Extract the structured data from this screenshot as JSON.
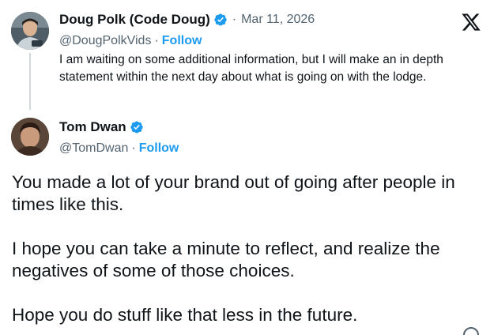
{
  "parent_tweet": {
    "author_name": "Doug Polk (Code Doug)",
    "verified": true,
    "separator": "·",
    "date": "Mar 11, 2026",
    "handle": "@DougPolkVids",
    "handle_separator": "·",
    "follow_label": "Follow",
    "text": "I am waiting on some additional information, but I will make an in depth statement within the next day about what is going on with the lodge."
  },
  "main_tweet": {
    "author_name": "Tom Dwan",
    "verified": true,
    "handle": "@TomDwan",
    "handle_separator": "·",
    "follow_label": "Follow",
    "paragraphs": [
      "You made a lot of your brand out of going after people in times like this.",
      "I hope you can take a minute to reflect, and realize the negatives of some of those choices.",
      "Hope you do stuff like that less in the future."
    ]
  },
  "icons": {
    "brand": "x-logo-icon",
    "verified": "verified-badge-icon",
    "info": "info-icon"
  },
  "colors": {
    "text_primary": "#0f1419",
    "text_secondary": "#536471",
    "accent_blue": "#1d9bf0",
    "thread_line": "#cfd9de",
    "background": "#ffffff"
  }
}
